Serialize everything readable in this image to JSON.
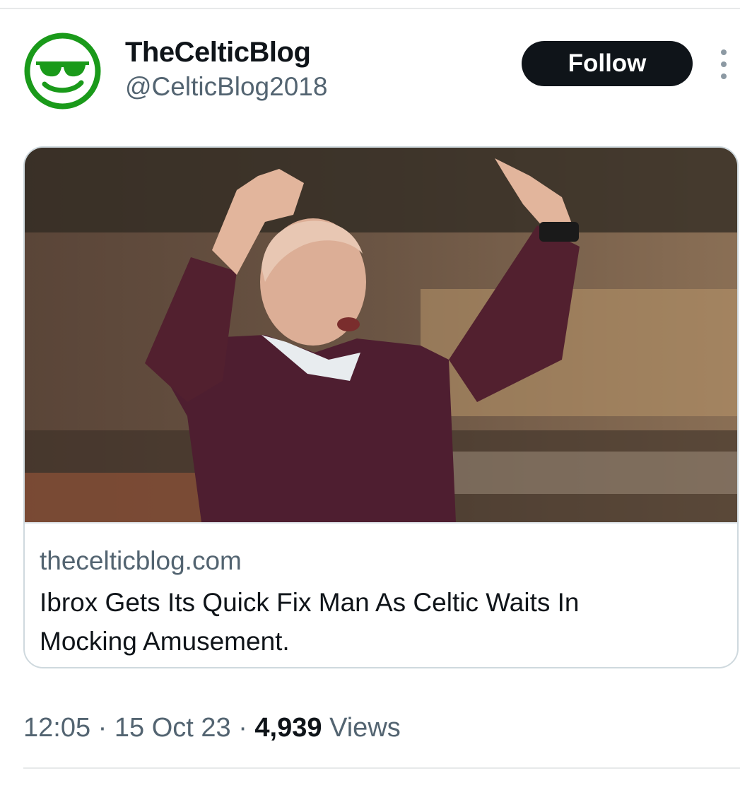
{
  "tweet": {
    "author": {
      "display_name": "TheCelticBlog",
      "handle": "@CelticBlog2018",
      "avatar_icon": "sunglasses-smiley-icon",
      "avatar_color": "#1a9a1a"
    },
    "follow_label": "Follow",
    "more_icon": "vertical-ellipsis-icon",
    "card": {
      "image_icon": "photo-man-in-maroon-sweater-pointing-up",
      "domain": "thecelticblog.com",
      "title": "Ibrox Gets Its Quick Fix Man As Celtic Waits In Mocking Amusement."
    },
    "meta": {
      "time": "12:05",
      "separator": "·",
      "date": "15 Oct 23",
      "views_count": "4,939",
      "views_label": "Views"
    }
  },
  "colors": {
    "text_primary": "#0f1419",
    "text_secondary": "#536471",
    "button_bg": "#0f1419",
    "border": "#cfd9de"
  }
}
